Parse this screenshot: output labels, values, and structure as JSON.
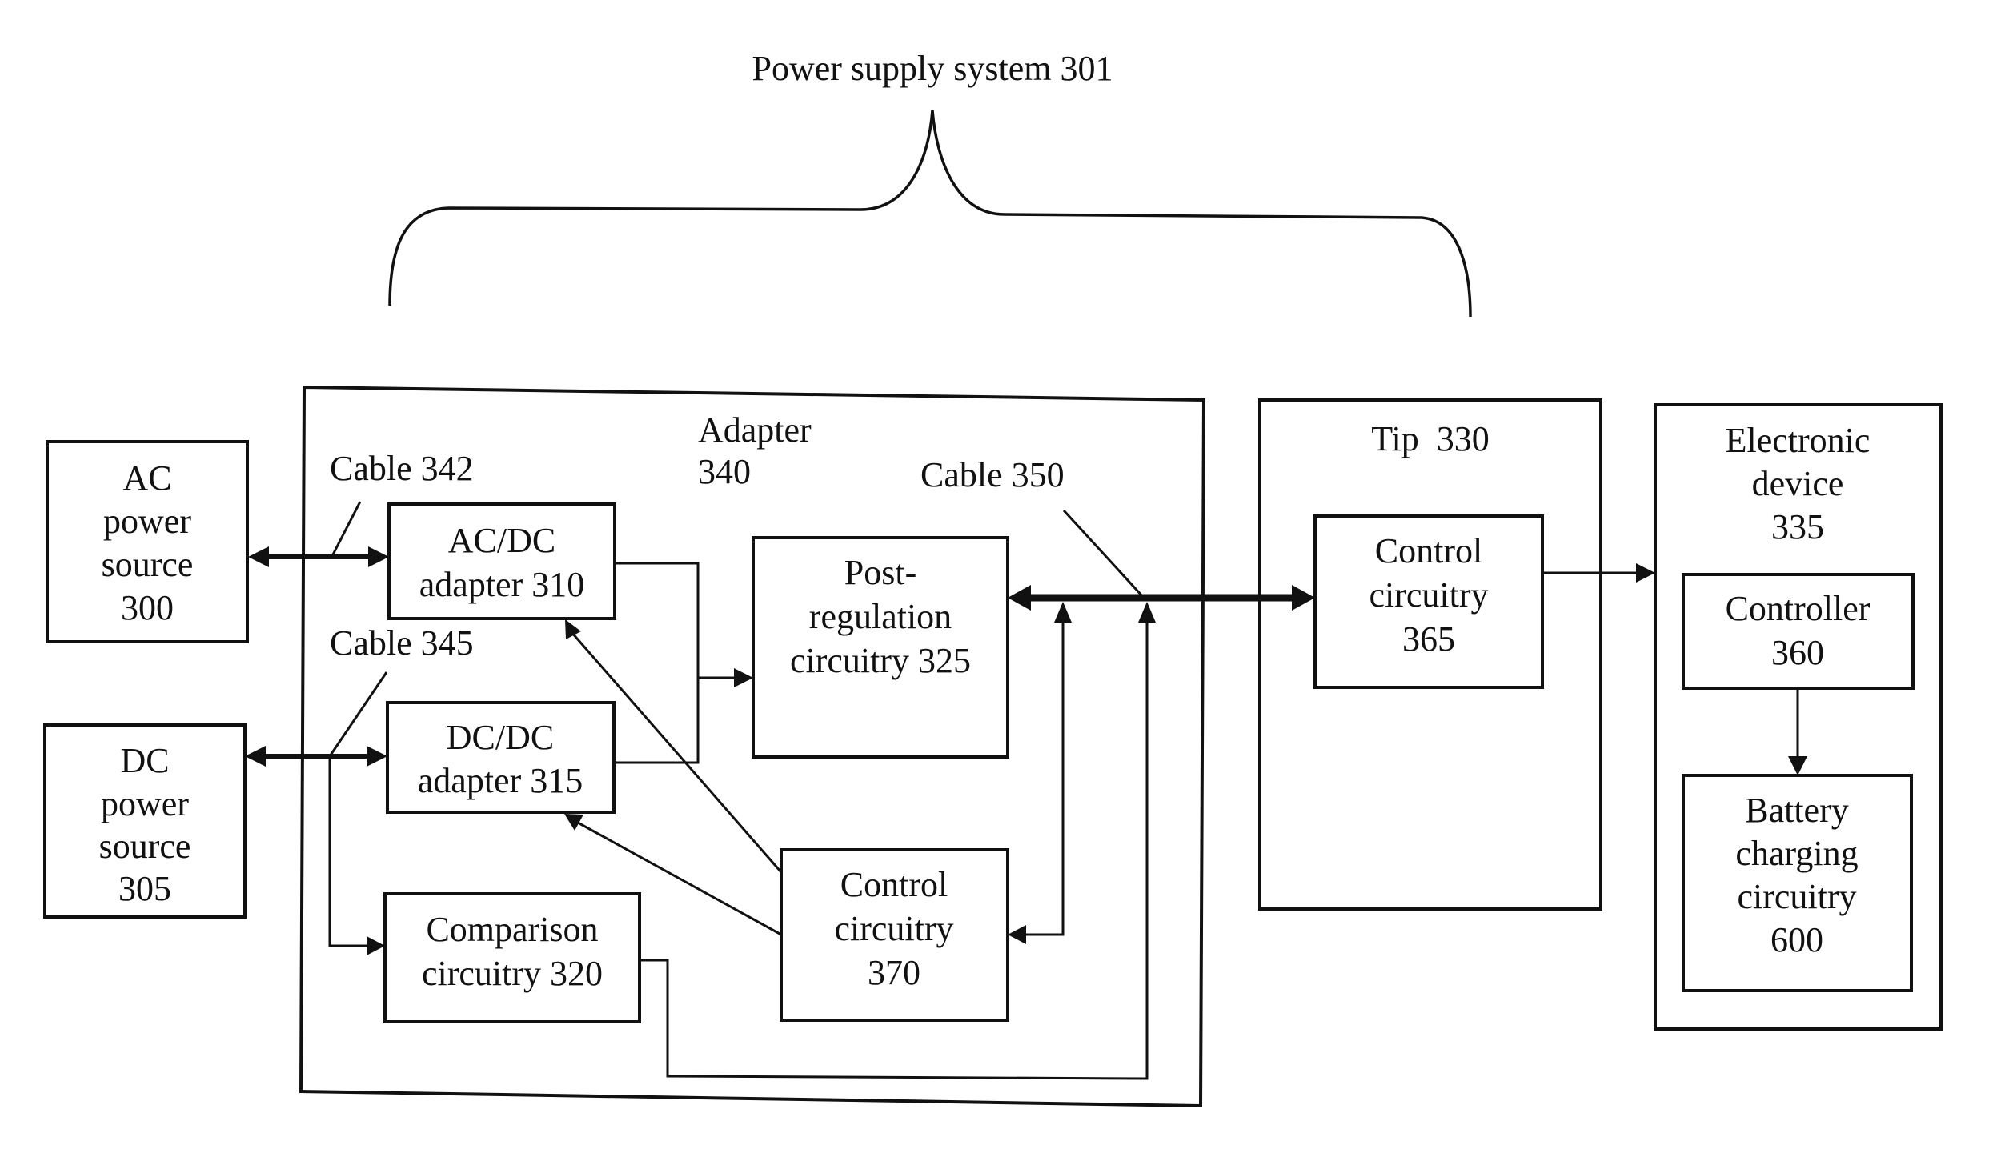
{
  "diagram": {
    "title": "Power supply system 301",
    "containers": {
      "adapter": {
        "lines": [
          "Adapter",
          "340"
        ]
      },
      "tip": {
        "lines": [
          "Tip  330"
        ]
      },
      "device": {
        "lines": [
          "Electronic",
          "device",
          "335"
        ]
      }
    },
    "blocks": {
      "ac_source": {
        "lines": [
          "AC",
          "power",
          "source",
          "300"
        ]
      },
      "dc_source": {
        "lines": [
          "DC",
          "power",
          "source",
          "305"
        ]
      },
      "acdc_adapter": {
        "lines": [
          "AC/DC",
          "adapter 310"
        ]
      },
      "dcdc_adapter": {
        "lines": [
          "DC/DC",
          "adapter 315"
        ]
      },
      "comparison": {
        "lines": [
          "Comparison",
          "circuitry 320"
        ]
      },
      "post_regulation": {
        "lines": [
          "Post-",
          "regulation",
          "circuitry 325"
        ]
      },
      "control_370": {
        "lines": [
          "Control",
          "circuitry",
          "370"
        ]
      },
      "control_365": {
        "lines": [
          "Control",
          "circuitry",
          "365"
        ]
      },
      "controller_360": {
        "lines": [
          "Controller",
          "360"
        ]
      },
      "battery_charging": {
        "lines": [
          "Battery",
          "charging",
          "circuitry",
          "600"
        ]
      }
    },
    "cables": {
      "cable_342": "Cable 342",
      "cable_345": "Cable 345",
      "cable_350": "Cable 350"
    },
    "connections": [
      {
        "from": "AC power source 300",
        "to": "AC/DC adapter 310",
        "via": "Cable 342",
        "type": "bidirectional"
      },
      {
        "from": "DC power source 305",
        "to": "DC/DC adapter 315",
        "via": "Cable 345",
        "type": "bidirectional"
      },
      {
        "from": "Cable 345",
        "to": "Comparison circuitry 320",
        "type": "directed"
      },
      {
        "from": "AC/DC adapter 310",
        "to": "Post-regulation circuitry 325",
        "type": "directed"
      },
      {
        "from": "DC/DC adapter 315",
        "to": "Post-regulation circuitry 325",
        "type": "directed"
      },
      {
        "from": "Control circuitry 370",
        "to": "AC/DC adapter 310",
        "type": "directed"
      },
      {
        "from": "Control circuitry 370",
        "to": "DC/DC adapter 315",
        "type": "directed"
      },
      {
        "from": "Post-regulation circuitry 325",
        "to": "Control circuitry 365",
        "via": "Cable 350",
        "type": "bidirectional"
      },
      {
        "from": "Cable 350",
        "to": "Control circuitry 370",
        "type": "directed"
      },
      {
        "from": "Comparison circuitry 320",
        "to": "Cable 350",
        "type": "directed"
      },
      {
        "from": "Control circuitry 365",
        "to": "Electronic device 335",
        "type": "directed"
      },
      {
        "from": "Controller 360",
        "to": "Battery charging circuitry 600",
        "type": "directed"
      }
    ]
  }
}
